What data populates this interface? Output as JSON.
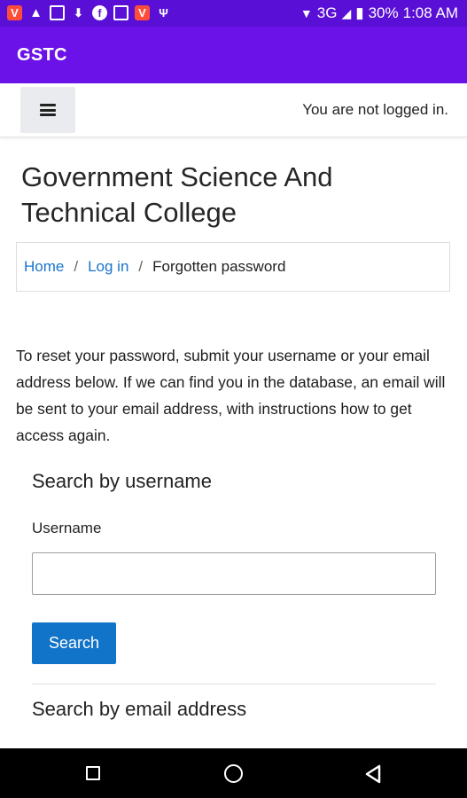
{
  "status_bar": {
    "left_icons": [
      "vivaldi-icon",
      "warning-icon",
      "gallery-icon",
      "download-icon",
      "facebook-icon",
      "mail-icon",
      "vivaldi-icon",
      "usb-icon"
    ],
    "network": "3G",
    "battery": "30%",
    "time": "1:08 AM"
  },
  "app": {
    "title": "GSTC"
  },
  "navbar": {
    "login_status": "You are not logged in."
  },
  "page": {
    "title": "Government Science And Technical College"
  },
  "breadcrumb": {
    "home": "Home",
    "separator": "/",
    "login": "Log in",
    "current": "Forgotten password"
  },
  "intro_text": "To reset your password, submit your username or your email address below. If we can find you in the database, an email will be sent to your email address, with instructions how to get access again.",
  "search_username": {
    "heading": "Search by username",
    "label": "Username",
    "value": "",
    "button_label": "Search"
  },
  "search_email": {
    "heading": "Search by email address"
  },
  "colors": {
    "status_bar": "#5a0fd6",
    "app_bar": "#6a12e8",
    "link": "#1a74c9",
    "primary_button": "#1274c9"
  }
}
